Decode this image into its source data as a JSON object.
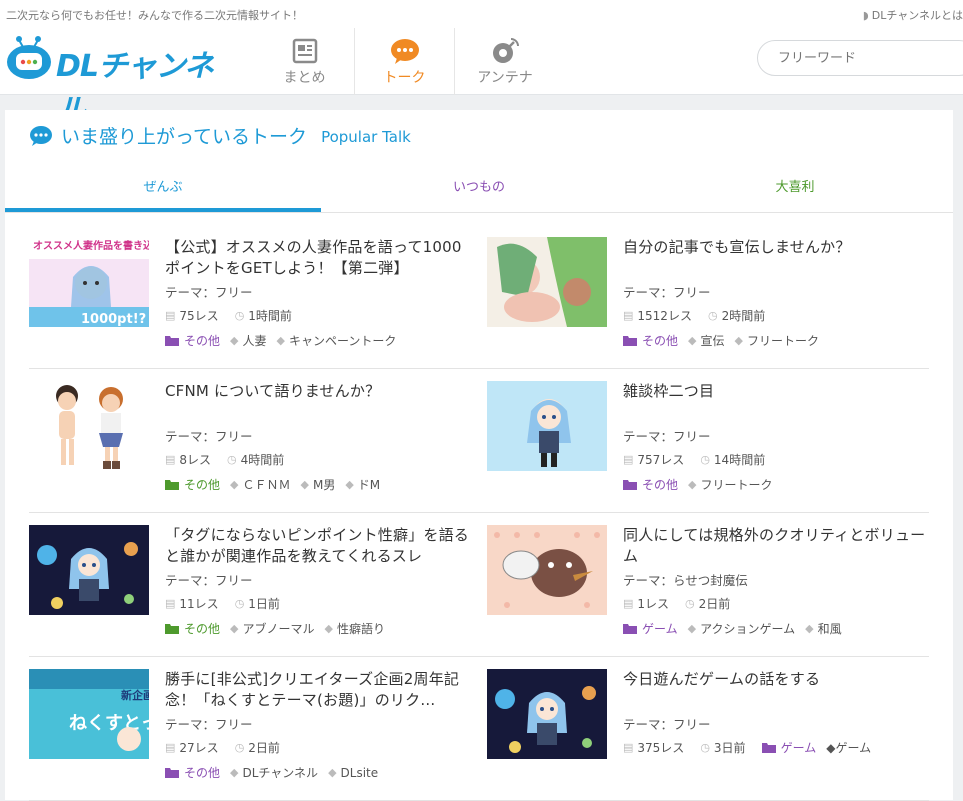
{
  "topbar": {
    "tagline": "二次元なら何でもお任せ！みんなで作る二次元情報サイト！",
    "about": "DLチャンネルとは"
  },
  "header": {
    "logo_text": "DLチャンネル",
    "nav": [
      {
        "label": "まとめ",
        "icon": "newspaper-icon"
      },
      {
        "label": "トーク",
        "icon": "speech-bubble-icon"
      },
      {
        "label": "アンテナ",
        "icon": "antenna-icon"
      }
    ],
    "search_placeholder": "フリーワード"
  },
  "section": {
    "title": "いま盛り上がっているトーク",
    "subtitle": "Popular Talk",
    "tabs": [
      "ぜんぶ",
      "いつもの",
      "大喜利"
    ]
  },
  "talks": [
    {
      "title": "【公式】オススメの人妻作品を語って1000ポイントをGETしよう！【第二弾】",
      "theme": "テーマ：フリー",
      "res": "75レス",
      "time": "1時間前",
      "category": "その他",
      "tags": [
        "人妻",
        "キャンペーントーク"
      ],
      "thumb_text": "オススメ人妻作品を書き込むと",
      "thumb_text2": "1000pt!?"
    },
    {
      "title": "自分の記事でも宣伝しませんか？",
      "theme": "テーマ：フリー",
      "res": "1512レス",
      "time": "2時間前",
      "category": "その他",
      "tags": [
        "宣伝",
        "フリートーク"
      ]
    },
    {
      "title": "CFNM について語りませんか？",
      "theme": "テーマ：フリー",
      "res": "8レス",
      "time": "4時間前",
      "category": "その他",
      "tags": [
        "ＣＦＮＭ",
        "M男",
        "ドM"
      ]
    },
    {
      "title": "雑談枠二つ目",
      "theme": "テーマ：フリー",
      "res": "757レス",
      "time": "14時間前",
      "category": "その他",
      "tags": [
        "フリートーク"
      ]
    },
    {
      "title": "「タグにならないピンポイント性癖」を語ると誰かが関連作品を教えてくれるスレ",
      "theme": "テーマ：フリー",
      "res": "11レス",
      "time": "1日前",
      "category": "その他",
      "tags": [
        "アブノーマル",
        "性癖語り"
      ]
    },
    {
      "title": "同人にしては規格外のクオリティとボリューム",
      "theme": "テーマ：らせつ封魔伝",
      "res": "1レス",
      "time": "2日前",
      "category": "ゲーム",
      "tags": [
        "アクションゲーム",
        "和風"
      ]
    },
    {
      "title": "勝手に[非公式]クリエイターズ企画2周年記念！「ねくすとテーマ(お題)」のリク…",
      "theme": "テーマ：フリー",
      "res": "27レス",
      "time": "2日前",
      "category": "その他",
      "tags": [
        "DLチャンネル",
        "DLsite"
      ],
      "thumb_text": "ねくすとっ",
      "thumb_text2": "新企画始動!"
    },
    {
      "title": "今日遊んだゲームの話をする",
      "theme": "テーマ：フリー",
      "res": "375レス",
      "time": "3日前",
      "category": "ゲーム",
      "tags": [
        "ゲーム"
      ]
    }
  ],
  "colors": {
    "accent_blue": "#1e9ad6",
    "orange": "#f08a24",
    "purple": "#8a4fb3",
    "green": "#4e9a2d"
  }
}
